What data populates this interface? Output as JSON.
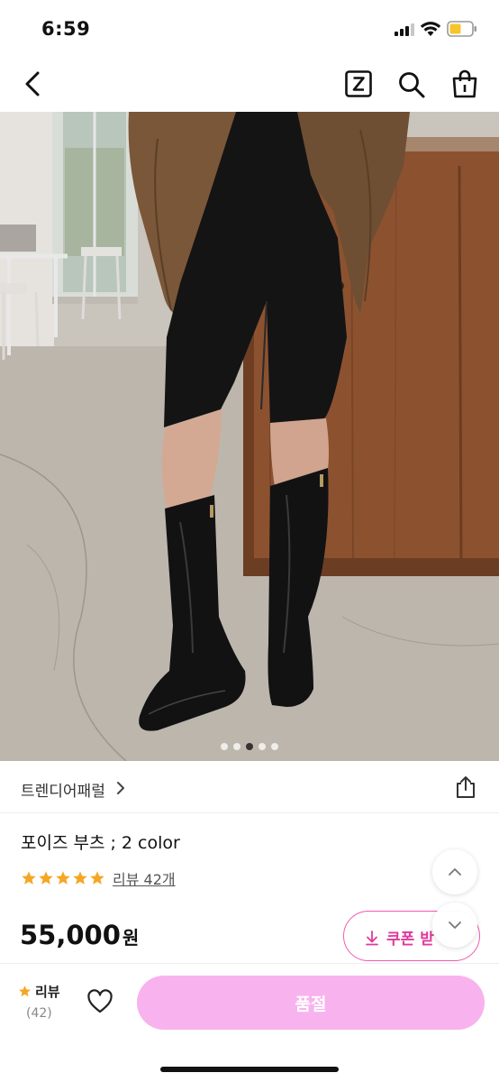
{
  "status_bar": {
    "time": "6:59"
  },
  "nav": {
    "icons": [
      "back-icon",
      "zigzag-z-icon",
      "search-icon",
      "shopping-bag-icon"
    ]
  },
  "gallery": {
    "image_count": 5,
    "active_index": 2
  },
  "brand": {
    "name": "트렌디어패럴"
  },
  "product": {
    "title": "포이즈 부츠 ; 2 color",
    "rating": 5,
    "review_link": "리뷰 42개",
    "price": "55,000",
    "price_unit": "원"
  },
  "coupon": {
    "label": "쿠폰 받"
  },
  "bottom_bar": {
    "review_label": "리뷰",
    "review_count": "(42)",
    "buy_label": "품절"
  },
  "colors": {
    "accent": "#e0399b",
    "soldout": "#f8b2ee",
    "star": "#f5a623"
  }
}
